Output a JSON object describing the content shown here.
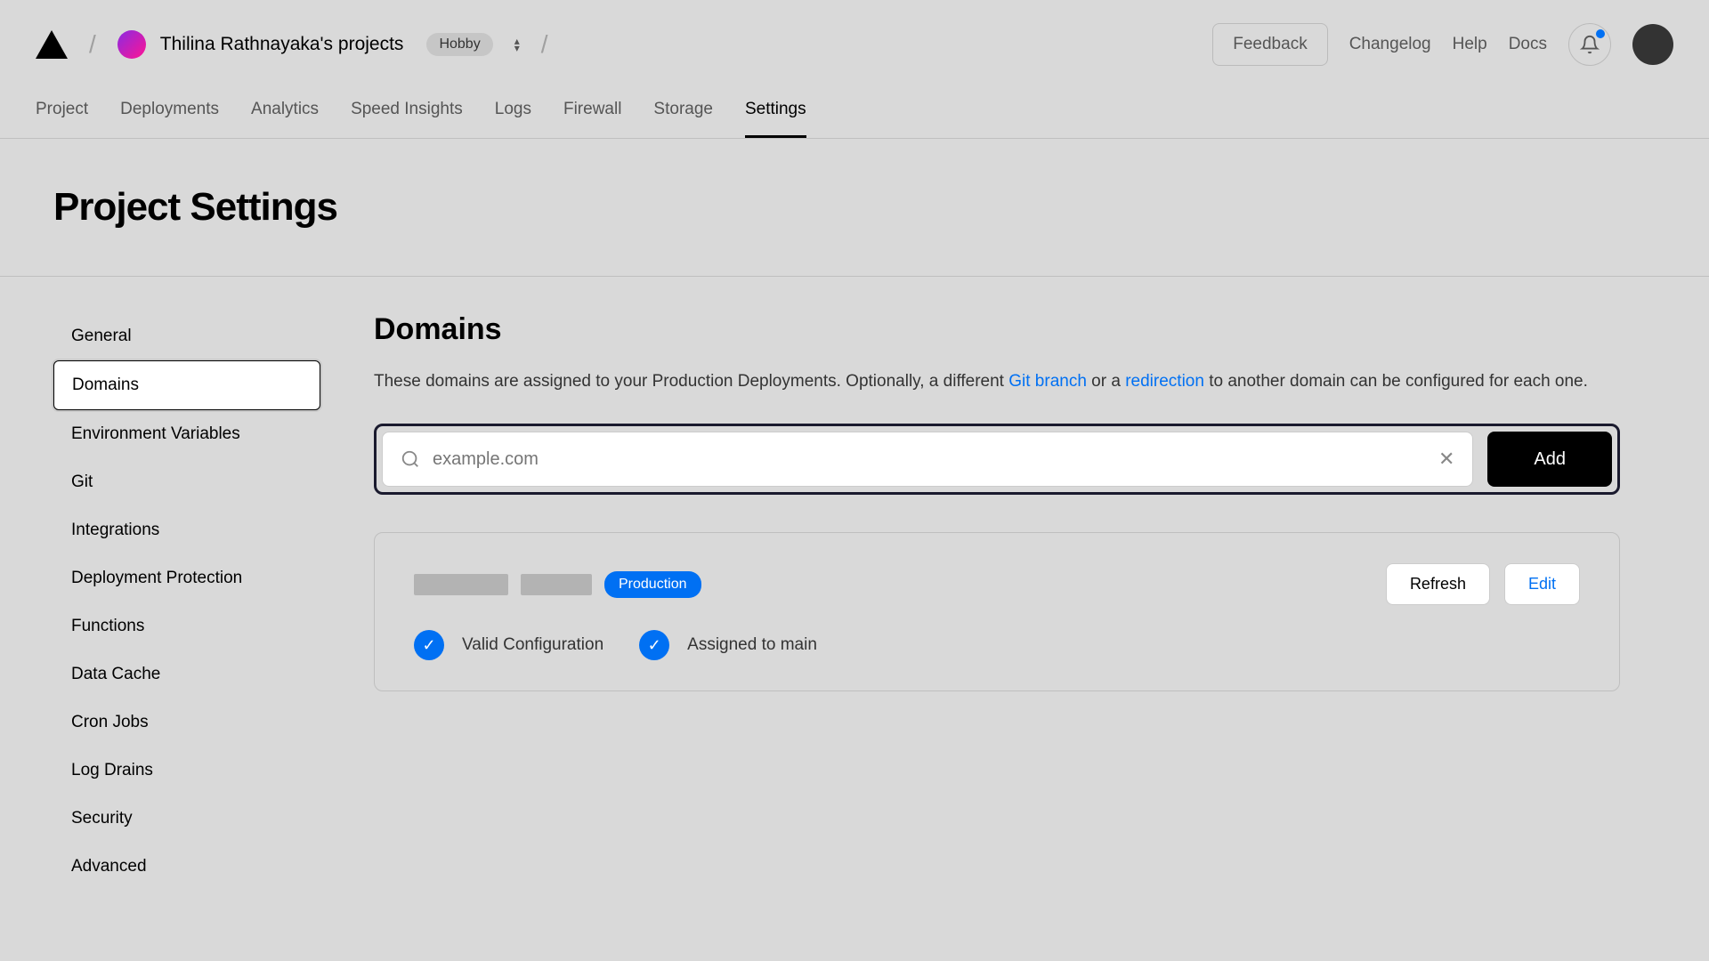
{
  "header": {
    "project_name": "Thilina Rathnayaka's projects",
    "plan_badge": "Hobby",
    "feedback": "Feedback",
    "links": [
      "Changelog",
      "Help",
      "Docs"
    ]
  },
  "tabs": [
    "Project",
    "Deployments",
    "Analytics",
    "Speed Insights",
    "Logs",
    "Firewall",
    "Storage",
    "Settings"
  ],
  "active_tab": "Settings",
  "page_title": "Project Settings",
  "sidebar": {
    "items": [
      "General",
      "Domains",
      "Environment Variables",
      "Git",
      "Integrations",
      "Deployment Protection",
      "Functions",
      "Data Cache",
      "Cron Jobs",
      "Log Drains",
      "Security",
      "Advanced"
    ],
    "active": "Domains"
  },
  "main": {
    "title": "Domains",
    "desc_1": "These domains are assigned to your Production Deployments. Optionally, a different ",
    "desc_link1": "Git branch",
    "desc_2": " or a ",
    "desc_link2": "redirection",
    "desc_3": " to another domain can be configured for each one.",
    "input_placeholder": "example.com",
    "input_value": "",
    "add_button": "Add",
    "domain_card": {
      "badge": "Production",
      "refresh": "Refresh",
      "edit": "Edit",
      "status1": "Valid Configuration",
      "status2": "Assigned to main"
    }
  }
}
